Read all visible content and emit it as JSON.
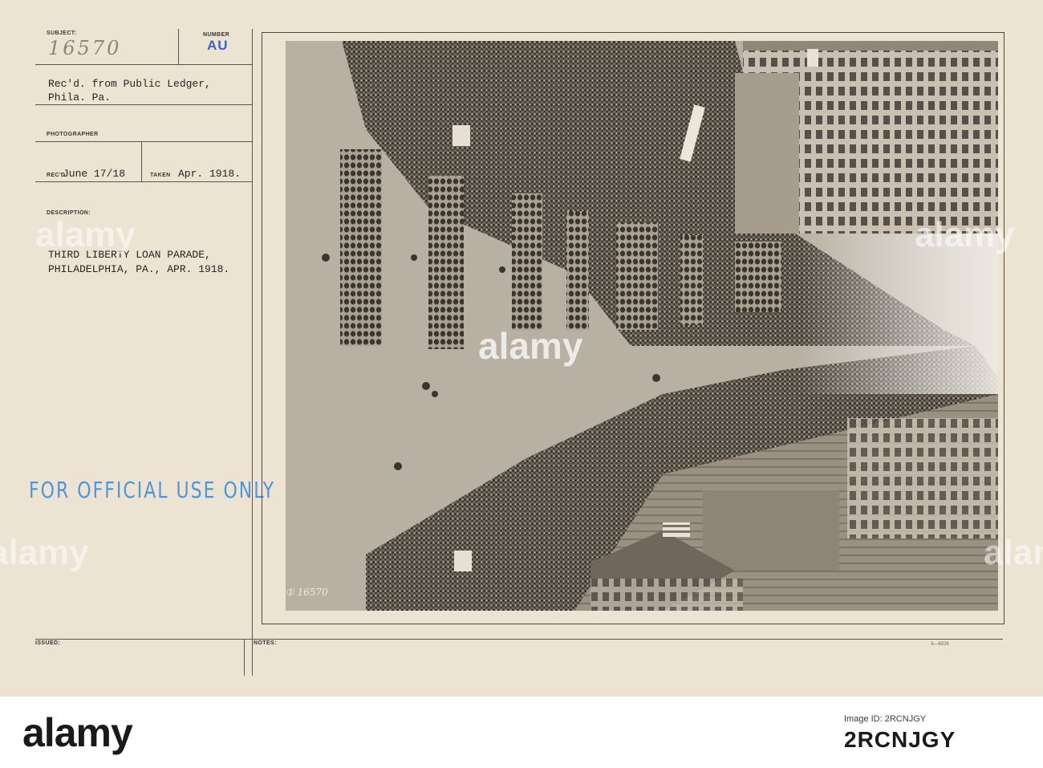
{
  "record": {
    "subject_label": "SUBJECT:",
    "subject_value": "16570",
    "number_label": "NUMBER",
    "number_value": "AU",
    "received_from_line1": "Rec'd. from Public Ledger,",
    "received_from_line2": "Phila. Pa.",
    "photographer_label": "PHOTOGRAPHER",
    "recd_label": "REC'D",
    "recd_value": "June 17/18",
    "taken_label": "TAKEN",
    "taken_value": "Apr. 1918.",
    "description_label": "DESCRIPTION:",
    "description_line1": "THIRD LIBERTY LOAN PARADE,",
    "description_line2": "PHILADELPHIA, PA., APR. 1918.",
    "stamp": "FOR OFFICIAL USE ONLY",
    "issued_label": "ISSUED:",
    "notes_label": "NOTES:",
    "form_number": "3—6026",
    "photo_number": "① 16570"
  },
  "watermark": {
    "text": "alamy"
  },
  "banner": {
    "brand": "alamy",
    "image_id_label": "Image ID: 2RCNJGY",
    "image_ref": "2RCNJGY"
  }
}
